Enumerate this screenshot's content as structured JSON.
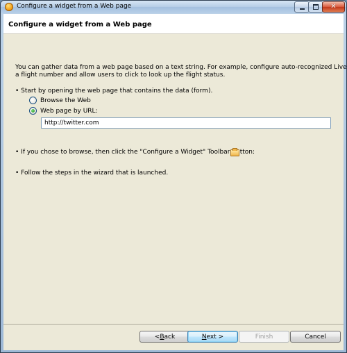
{
  "window": {
    "title": "Configure a widget from a Web page",
    "close_glyph": "✕"
  },
  "header": {
    "title": "Configure a widget from a Web page"
  },
  "content": {
    "intro_line_1": "You can gather data from a web page based on a text string. For example,  configure auto-recognized Live Text for",
    "intro_line_2": "a flight number and allow users to click to look up the flight status.",
    "step_1": "• Start by opening the web page that contains the data (form).",
    "options": [
      {
        "label": "Browse the Web",
        "checked": false
      },
      {
        "label": "Web page by URL:",
        "checked": true
      }
    ],
    "url_value": "http://twitter.com",
    "step_2": "• If you chose to browse, then click the \"Configure a Widget\" Toolbar button:",
    "step_2_icon": "configure-widget-icon",
    "step_3": "• Follow the steps in the wizard that is launched."
  },
  "footer": {
    "back_prefix": "< ",
    "back_mnemonic": "B",
    "back_rest": "ack",
    "next_mnemonic": "N",
    "next_rest": "ext >",
    "finish_label": "Finish",
    "cancel_label": "Cancel"
  }
}
